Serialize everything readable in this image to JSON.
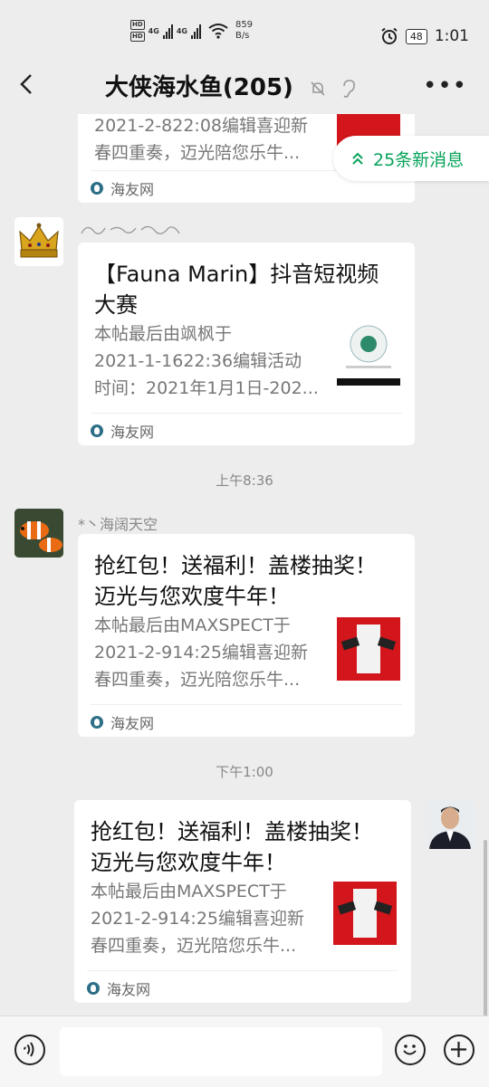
{
  "status_bar": {
    "hd1": "HD",
    "hd2": "HD",
    "net1": "4G",
    "net2": "4G",
    "speed_value": "859",
    "speed_unit": "B/s",
    "battery": "48",
    "time": "1:01"
  },
  "header": {
    "title": "大侠海水鱼(205)"
  },
  "new_messages": "25条新消息",
  "messages": [
    {
      "desc_line1": "2021-2-822:08编辑喜迎新",
      "desc_line2": "春四重奏，迈光陪您乐牛...",
      "source": "海友网"
    },
    {
      "title_line1": "【Fauna Marin】抖音短视频",
      "title_line2": "大赛",
      "desc_line1": "本帖最后由飒枫于",
      "desc_line2": "2021-1-1622:36编辑活动",
      "desc_line3": "时间：2021年1月1日-202...",
      "source": "海友网"
    },
    {
      "time": "上午8:36",
      "sender": "*丶海阔天空",
      "title_line1": "抢红包！送福利！盖楼抽奖！",
      "title_line2": "迈光与您欢度牛年！",
      "desc_line1": "本帖最后由MAXSPECT于",
      "desc_line2": "2021-2-914:25编辑喜迎新",
      "desc_line3": "春四重奏，迈光陪您乐牛...",
      "source": "海友网"
    },
    {
      "time": "下午1:00",
      "title_line1": "抢红包！送福利！盖楼抽奖！",
      "title_line2": "迈光与您欢度牛年！",
      "desc_line1": "本帖最后由MAXSPECT于",
      "desc_line2": "2021-2-914:25编辑喜迎新",
      "desc_line3": "春四重奏，迈光陪您乐牛...",
      "source": "海友网"
    }
  ],
  "colors": {
    "background": "#ededed",
    "accent_green": "#07a35a",
    "card": "#ffffff"
  },
  "icons": [
    "back-icon",
    "mute-bell-icon",
    "ear-icon",
    "more-icon",
    "voice-icon",
    "emoji-icon",
    "plus-icon",
    "alarm-icon",
    "wifi-icon",
    "source-logo-icon"
  ]
}
